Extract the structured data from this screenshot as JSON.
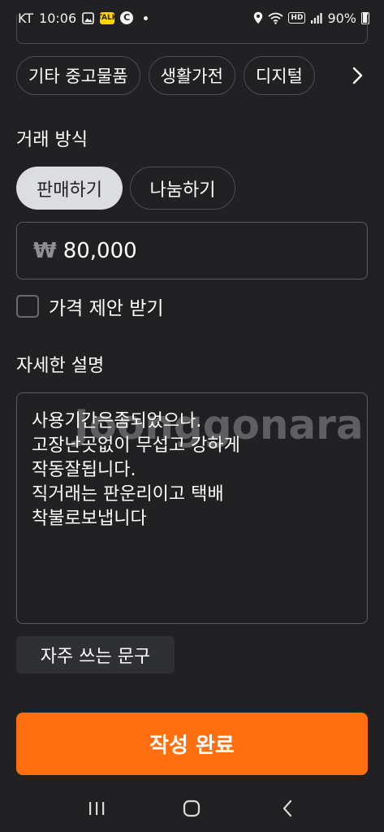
{
  "status_bar": {
    "carrier": "KT",
    "time": "10:06",
    "battery": "90%",
    "icons": [
      "gallery-icon",
      "kakao-icon",
      "c-icon",
      "dot-icon",
      "location-icon",
      "wifi-icon",
      "hd-icon",
      "signal-icon",
      "battery-icon"
    ]
  },
  "categories": {
    "chips": [
      "기타 중고물품",
      "생활가전",
      "디지털"
    ],
    "more_icon": "chevron-right-icon"
  },
  "trade": {
    "label": "거래 방식",
    "options": [
      "판매하기",
      "나눔하기"
    ],
    "selected": "판매하기"
  },
  "price": {
    "currency_symbol": "₩",
    "value": "80,000"
  },
  "offer": {
    "label": "가격 제안 받기",
    "checked": false
  },
  "description": {
    "label": "자세한 설명",
    "watermark": "Joonggonara",
    "text": "사용기간은좀되었으나.\n고장난곳없이 무섭고 강하게\n작동잘됩니다.\n직거래는 판운리이고 택배\n착불로보냅니다"
  },
  "frequent_phrases": {
    "label": "자주 쓰는 문구"
  },
  "submit": {
    "label": "작성 완료"
  },
  "colors": {
    "background": "#212124",
    "accent": "#ff6f0f",
    "active_chip": "#dcdde1",
    "border": "#4d4d52"
  }
}
